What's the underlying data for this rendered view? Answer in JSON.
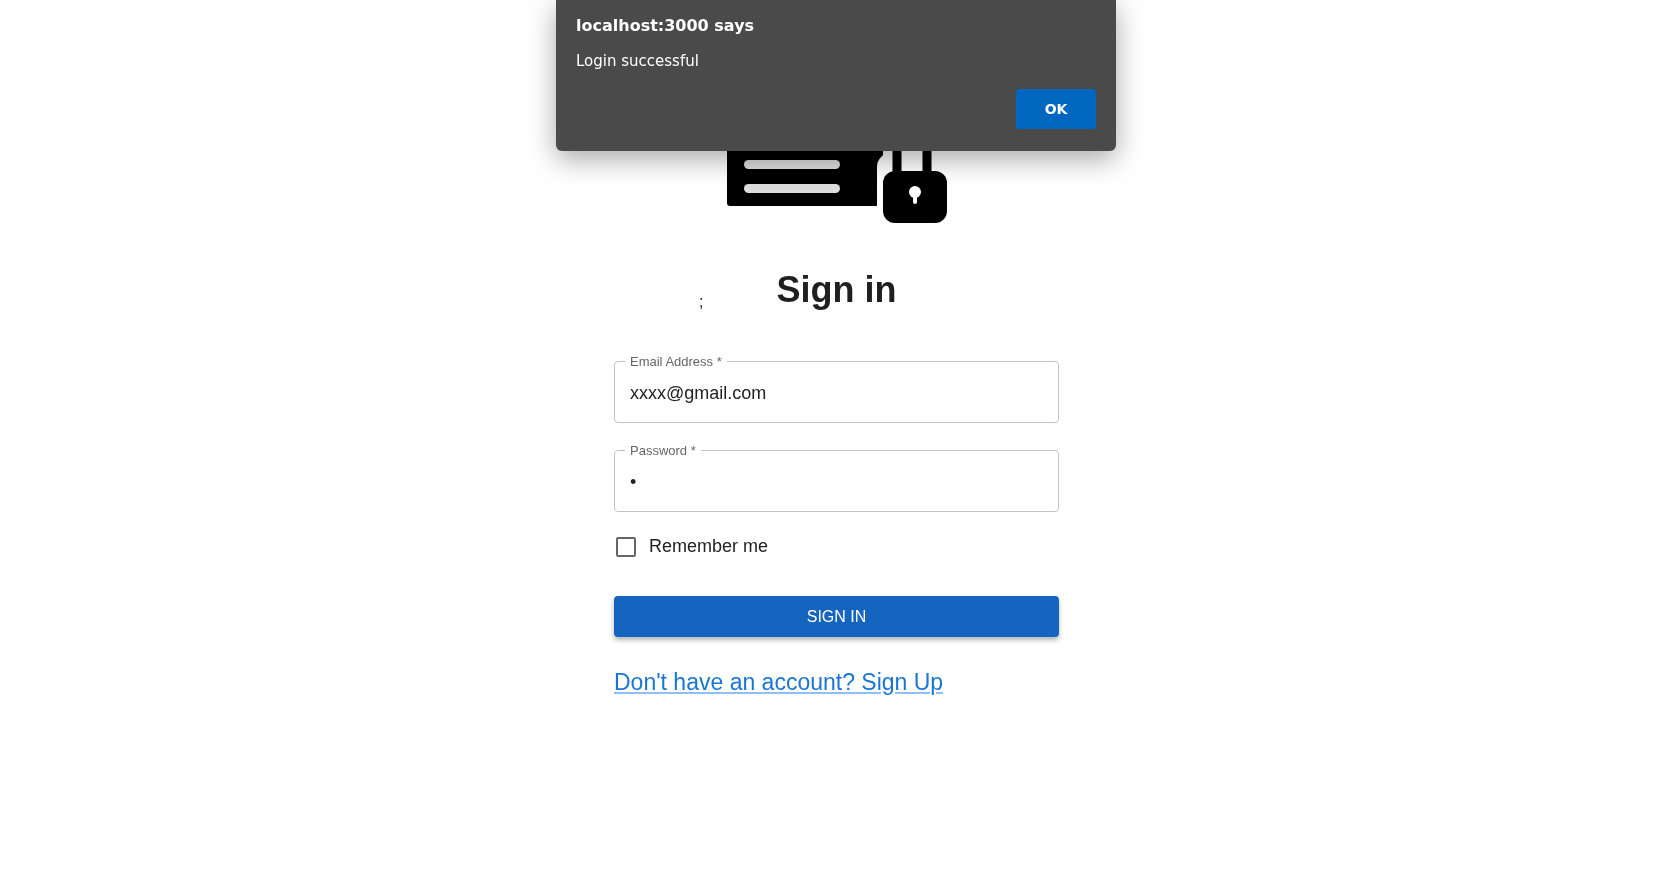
{
  "dialog": {
    "title": "localhost:3000 says",
    "message": "Login successful",
    "button": "OK"
  },
  "stray_text": ";",
  "heading": "Sign in",
  "fields": [
    {
      "label": "Email Address *",
      "value": "xxxx@gmail.com"
    },
    {
      "label": "Password *",
      "value": "•"
    }
  ],
  "remember": {
    "label": "Remember me",
    "checked": false
  },
  "submit": "SIGN IN",
  "signup_link": "Don't have an account? Sign Up"
}
